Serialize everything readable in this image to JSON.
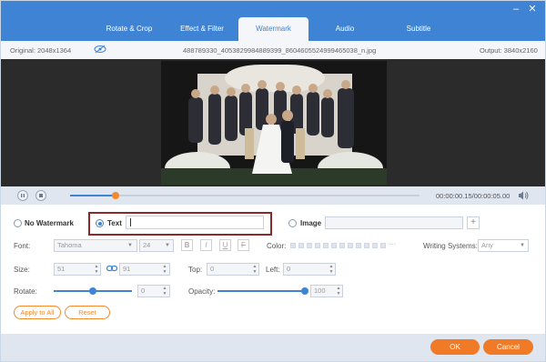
{
  "tabs": [
    {
      "label": "Rotate & Crop"
    },
    {
      "label": "Effect & Filter"
    },
    {
      "label": "Watermark"
    },
    {
      "label": "Audio"
    },
    {
      "label": "Subtitle"
    }
  ],
  "info": {
    "original": "Original: 2048x1364",
    "filename": "488789330_4053829984889399_8604605524999465038_n.jpg",
    "output": "Output: 3840x2160"
  },
  "player": {
    "time": "00:00:00.15/00:00:05.00",
    "progress_fraction": 0.13
  },
  "watermark": {
    "no_watermark_label": "No Watermark",
    "text_label": "Text",
    "text_value": "",
    "image_label": "Image",
    "image_value": "",
    "add_symbol": "+",
    "selected": "text"
  },
  "font": {
    "label": "Font:",
    "family": "Tahoma",
    "size": "24",
    "bold": "B",
    "italic": "I",
    "underline": "U",
    "strike": "F",
    "color_label": "Color:",
    "more": "···",
    "writing_label": "Writing Systems:",
    "writing_value": "Any"
  },
  "size": {
    "label": "Size:",
    "width": "51",
    "height": "91",
    "top_label": "Top:",
    "top_value": "0",
    "left_label": "Left:",
    "left_value": "0"
  },
  "rotate": {
    "label": "Rotate:",
    "value": "0",
    "opacity_label": "Opacity:",
    "opacity_value": "100"
  },
  "actions": {
    "apply_all": "Apply to All",
    "reset": "Reset"
  },
  "footer": {
    "ok": "OK",
    "cancel": "Cancel"
  },
  "colors": {
    "accent": "#3f84d4",
    "orange": "#f07a26",
    "highlight": "#8b2a2a"
  }
}
